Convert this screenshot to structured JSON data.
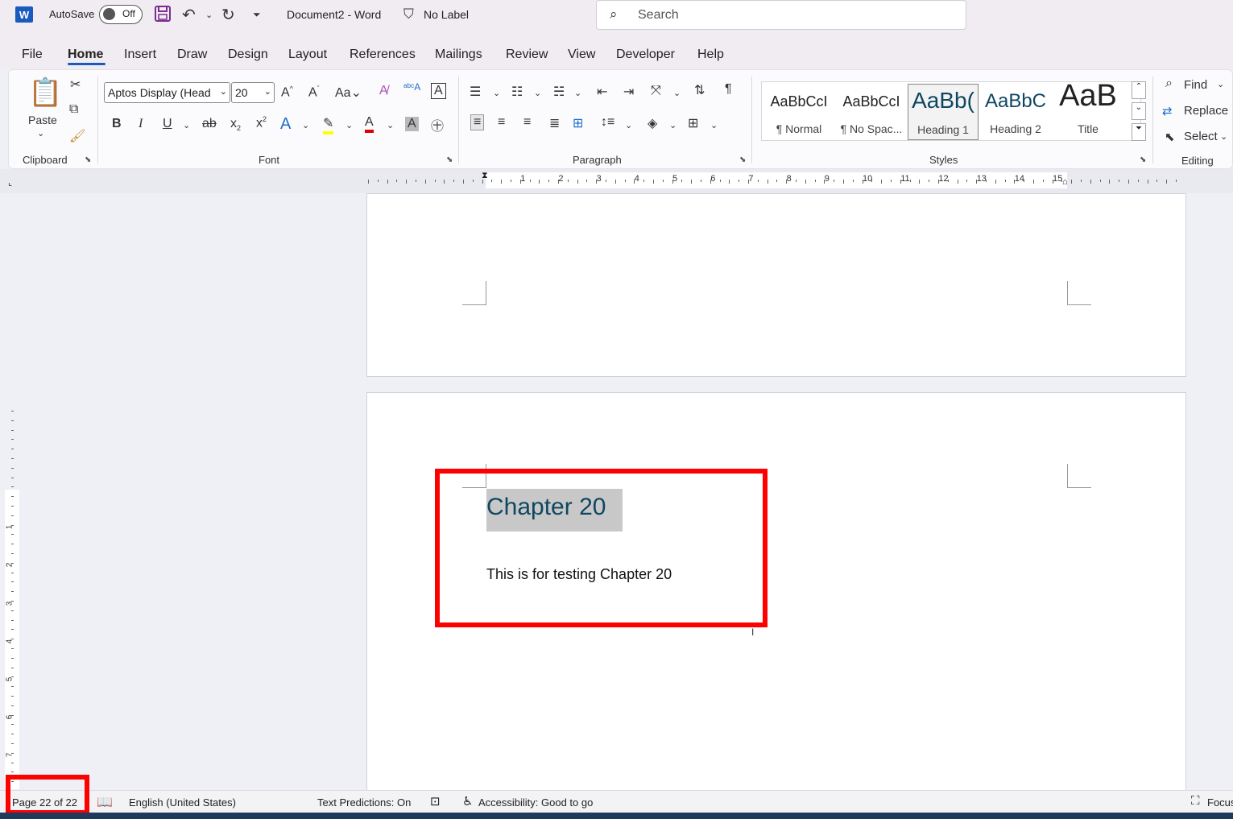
{
  "titlebar": {
    "app_icon_letter": "W",
    "autosave_label": "AutoSave",
    "autosave_state": "Off",
    "document_title": "Document2  -  Word",
    "sensitivity_label": "No Label",
    "search_placeholder": "Search"
  },
  "tabs": [
    "File",
    "Home",
    "Insert",
    "Draw",
    "Design",
    "Layout",
    "References",
    "Mailings",
    "Review",
    "View",
    "Developer",
    "Help"
  ],
  "ribbon": {
    "clipboard": {
      "paste_label": "Paste",
      "group_label": "Clipboard"
    },
    "font": {
      "font_name": "Aptos Display (Head",
      "font_size": "20",
      "group_label": "Font"
    },
    "paragraph": {
      "group_label": "Paragraph"
    },
    "styles": {
      "group_label": "Styles",
      "tiles": [
        {
          "sample": "AaBbCcI",
          "name": "¶ Normal"
        },
        {
          "sample": "AaBbCcI",
          "name": "¶ No Spac..."
        },
        {
          "sample": "AaBb(",
          "name": "Heading 1"
        },
        {
          "sample": "AaBbC",
          "name": "Heading 2"
        },
        {
          "sample": "AaB",
          "name": "Title"
        }
      ]
    },
    "editing": {
      "find": "Find",
      "replace": "Replace",
      "select": "Select",
      "group_label": "Editing"
    }
  },
  "ruler": {
    "numbers": [
      "1",
      "2",
      "3",
      "4",
      "5",
      "6",
      "7",
      "8",
      "9",
      "10",
      "11",
      "12",
      "13",
      "14",
      "15"
    ]
  },
  "vruler": {
    "numbers": [
      "1",
      "2",
      "3",
      "4",
      "5",
      "6",
      "7"
    ]
  },
  "document": {
    "heading": "Chapter 20",
    "body": "This is for testing Chapter 20"
  },
  "statusbar": {
    "page": "Page 22 of 22",
    "language": "English (United States)",
    "text_predictions": "Text Predictions: On",
    "accessibility": "Accessibility: Good to go",
    "focus": "Focus"
  },
  "colors": {
    "accent": "#185abd",
    "heading_text": "#0f4761",
    "highlight_box": "#ff0000",
    "selection": "#c8c8c8"
  }
}
